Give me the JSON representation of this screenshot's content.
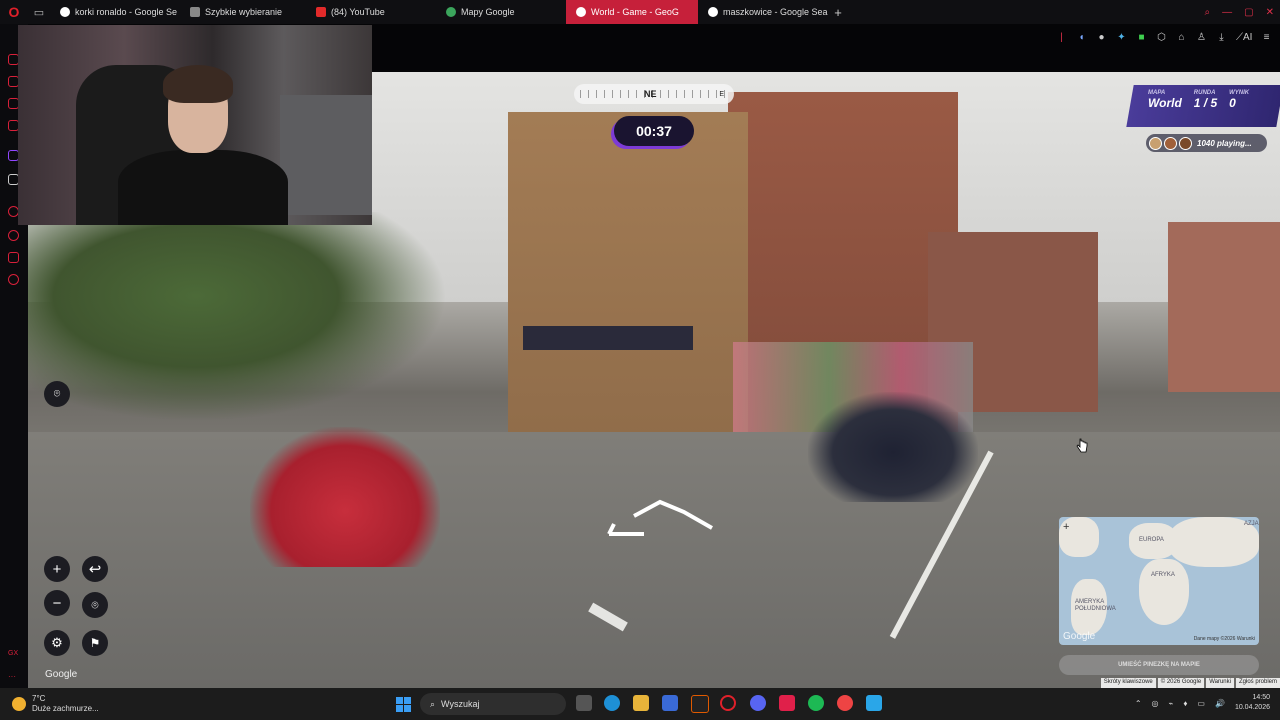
{
  "browser": {
    "tabs": [
      {
        "label": "korki ronaldo - Google Se",
        "color": "#ffffff"
      },
      {
        "label": "Szybkie wybieranie",
        "color": "#888888"
      },
      {
        "label": "(84) YouTube",
        "color": "#e22a2a"
      },
      {
        "label": "Mapy Google",
        "color": "#3ba55c"
      },
      {
        "label": "World - Game - GeoG",
        "color": "#ffffff",
        "active": true
      },
      {
        "label": "maszkowice - Google Sea",
        "color": "#ffffff"
      }
    ],
    "new_tab": "+",
    "accent": "#c6203a"
  },
  "game": {
    "compass_heading": "NE",
    "compass_east": "E",
    "timer": "00:37",
    "map_label": "MAPA",
    "map_value": "World",
    "round_label": "RUNDA",
    "round_value": "1 / 5",
    "score_label": "WYNIK",
    "score_value": "0",
    "playing": "1040 playing...",
    "guess_button": "UMIEŚĆ PINEZKĘ NA MAPIE",
    "google_watermark": "Google"
  },
  "minimap": {
    "labels": {
      "europe": "EUROPA",
      "asia": "AZJA",
      "africa": "AFRYKA",
      "south_america": "AMERYKA POŁUDNIOWA"
    },
    "google": "Google",
    "footer": "Dane mapy ©2026   Warunki"
  },
  "attribution": [
    "Skróty klawiszowe",
    "© 2026 Google",
    "Warunki",
    "Zgłoś problem"
  ],
  "taskbar": {
    "temperature": "7°C",
    "weather": "Duże zachmurze...",
    "search_placeholder": "Wyszukaj",
    "time": "14:50",
    "date": "10.04.2026"
  }
}
